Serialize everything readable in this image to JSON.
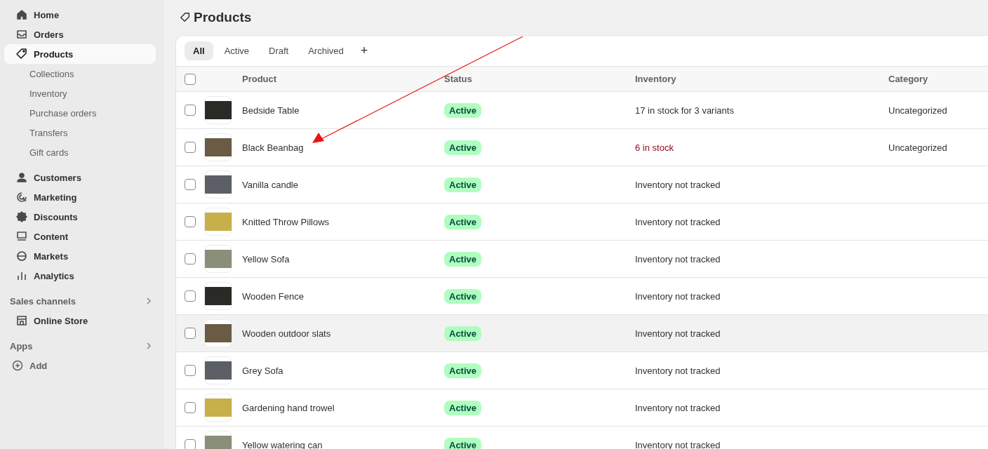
{
  "sidebar": {
    "items": [
      {
        "kind": "main",
        "label": "Home",
        "selected": false
      },
      {
        "kind": "main",
        "label": "Orders",
        "selected": false
      },
      {
        "kind": "main",
        "label": "Products",
        "selected": true
      },
      {
        "kind": "sub",
        "label": "Collections",
        "selected": false
      },
      {
        "kind": "sub",
        "label": "Inventory",
        "selected": false
      },
      {
        "kind": "sub",
        "label": "Purchase orders",
        "selected": false
      },
      {
        "kind": "sub",
        "label": "Transfers",
        "selected": false
      },
      {
        "kind": "sub",
        "label": "Gift cards",
        "selected": false
      },
      {
        "kind": "main",
        "label": "Customers",
        "selected": false
      },
      {
        "kind": "main",
        "label": "Marketing",
        "selected": false
      },
      {
        "kind": "main",
        "label": "Discounts",
        "selected": false
      },
      {
        "kind": "main",
        "label": "Content",
        "selected": false
      },
      {
        "kind": "main",
        "label": "Markets",
        "selected": false
      },
      {
        "kind": "main",
        "label": "Analytics",
        "selected": false
      },
      {
        "kind": "section",
        "label": "Sales channels",
        "selected": false
      },
      {
        "kind": "main",
        "label": "Online Store",
        "selected": false
      },
      {
        "kind": "section",
        "label": "Apps",
        "selected": false
      },
      {
        "kind": "add",
        "label": "Add",
        "selected": false
      }
    ]
  },
  "page": {
    "title": "Products"
  },
  "tabs": [
    {
      "label": "All",
      "selected": true
    },
    {
      "label": "Active",
      "selected": false
    },
    {
      "label": "Draft",
      "selected": false
    },
    {
      "label": "Archived",
      "selected": false
    }
  ],
  "add_tab": "+",
  "table": {
    "select_all_checked": false,
    "columns": [
      "Product",
      "Status",
      "Inventory",
      "Category"
    ],
    "rows": [
      {
        "product": "Bedside Table",
        "status": "Active",
        "inventory": "17 in stock for 3 variants",
        "low_stock": false,
        "category": "Uncategorized",
        "checked": false,
        "highlighted": false
      },
      {
        "product": "Black Beanbag",
        "status": "Active",
        "inventory": "6 in stock",
        "low_stock": true,
        "category": "Uncategorized",
        "checked": false,
        "highlighted": false
      },
      {
        "product": "Vanilla candle",
        "status": "Active",
        "inventory": "Inventory not tracked",
        "low_stock": false,
        "checked": false,
        "highlighted": false
      },
      {
        "product": "Knitted Throw Pillows",
        "status": "Active",
        "inventory": "Inventory not tracked",
        "low_stock": false,
        "checked": false,
        "highlighted": false
      },
      {
        "product": "Yellow Sofa",
        "status": "Active",
        "inventory": "Inventory not tracked",
        "low_stock": false,
        "checked": false,
        "highlighted": false
      },
      {
        "product": "Wooden Fence",
        "status": "Active",
        "inventory": "Inventory not tracked",
        "low_stock": false,
        "checked": false,
        "highlighted": false
      },
      {
        "product": "Wooden outdoor slats",
        "status": "Active",
        "inventory": "Inventory not tracked",
        "low_stock": false,
        "checked": false,
        "highlighted": true
      },
      {
        "product": "Grey Sofa",
        "status": "Active",
        "inventory": "Inventory not tracked",
        "low_stock": false,
        "checked": false,
        "highlighted": false
      },
      {
        "product": "Gardening hand trowel",
        "status": "Active",
        "inventory": "Inventory not tracked",
        "low_stock": false,
        "checked": false,
        "highlighted": false
      },
      {
        "product": "Yellow watering can",
        "status": "Active",
        "inventory": "Inventory not tracked",
        "low_stock": false,
        "checked": false,
        "highlighted": false
      }
    ]
  }
}
